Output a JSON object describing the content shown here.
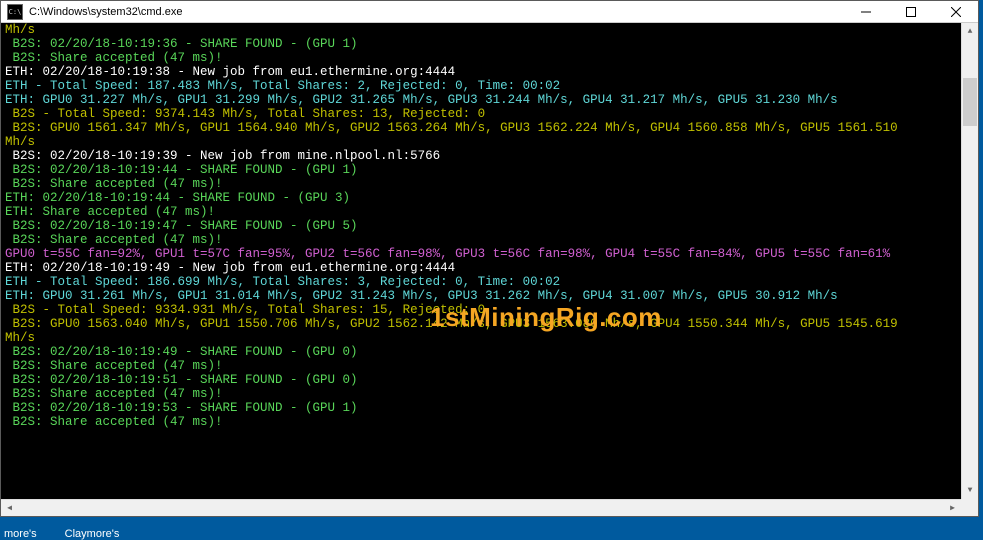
{
  "window": {
    "title": "C:\\Windows\\system32\\cmd.exe",
    "icon_text": "C:\\"
  },
  "watermark": "1stMiningRig.com",
  "taskbar": {
    "item1": "more's",
    "item2": "Claymore's"
  },
  "lines": [
    {
      "cls": "c-yellow",
      "text": "Mh/s"
    },
    {
      "cls": "c-green",
      "text": " B2S: 02/20/18-10:19:36 - SHARE FOUND - (GPU 1)"
    },
    {
      "cls": "c-green",
      "text": " B2S: Share accepted (47 ms)!"
    },
    {
      "cls": "c-white",
      "text": "ETH: 02/20/18-10:19:38 - New job from eu1.ethermine.org:4444"
    },
    {
      "cls": "c-cyan",
      "text": "ETH - Total Speed: 187.483 Mh/s, Total Shares: 2, Rejected: 0, Time: 00:02"
    },
    {
      "cls": "c-cyan",
      "text": "ETH: GPU0 31.227 Mh/s, GPU1 31.299 Mh/s, GPU2 31.265 Mh/s, GPU3 31.244 Mh/s, GPU4 31.217 Mh/s, GPU5 31.230 Mh/s"
    },
    {
      "cls": "c-yellow",
      "text": " B2S - Total Speed: 9374.143 Mh/s, Total Shares: 13, Rejected: 0"
    },
    {
      "cls": "c-yellow",
      "text": " B2S: GPU0 1561.347 Mh/s, GPU1 1564.940 Mh/s, GPU2 1563.264 Mh/s, GPU3 1562.224 Mh/s, GPU4 1560.858 Mh/s, GPU5 1561.510"
    },
    {
      "cls": "c-yellow",
      "text": "Mh/s"
    },
    {
      "cls": "c-white",
      "text": " B2S: 02/20/18-10:19:39 - New job from mine.nlpool.nl:5766"
    },
    {
      "cls": "c-green",
      "text": " B2S: 02/20/18-10:19:44 - SHARE FOUND - (GPU 1)"
    },
    {
      "cls": "c-green",
      "text": " B2S: Share accepted (47 ms)!"
    },
    {
      "cls": "c-green",
      "text": "ETH: 02/20/18-10:19:44 - SHARE FOUND - (GPU 3)"
    },
    {
      "cls": "c-green",
      "text": "ETH: Share accepted (47 ms)!"
    },
    {
      "cls": "c-green",
      "text": " B2S: 02/20/18-10:19:47 - SHARE FOUND - (GPU 5)"
    },
    {
      "cls": "c-green",
      "text": " B2S: Share accepted (47 ms)!"
    },
    {
      "cls": "c-magenta",
      "text": "GPU0 t=55C fan=92%, GPU1 t=57C fan=95%, GPU2 t=56C fan=98%, GPU3 t=56C fan=98%, GPU4 t=55C fan=84%, GPU5 t=55C fan=61%"
    },
    {
      "cls": "c-white",
      "text": "ETH: 02/20/18-10:19:49 - New job from eu1.ethermine.org:4444"
    },
    {
      "cls": "c-cyan",
      "text": "ETH - Total Speed: 186.699 Mh/s, Total Shares: 3, Rejected: 0, Time: 00:02"
    },
    {
      "cls": "c-cyan",
      "text": "ETH: GPU0 31.261 Mh/s, GPU1 31.014 Mh/s, GPU2 31.243 Mh/s, GPU3 31.262 Mh/s, GPU4 31.007 Mh/s, GPU5 30.912 Mh/s"
    },
    {
      "cls": "c-yellow",
      "text": " B2S - Total Speed: 9334.931 Mh/s, Total Shares: 15, Rejected: 0"
    },
    {
      "cls": "c-yellow",
      "text": " B2S: GPU0 1563.040 Mh/s, GPU1 1550.706 Mh/s, GPU2 1562.142 Mh/s, GPU3 1563.080 Mh/s, GPU4 1550.344 Mh/s, GPU5 1545.619"
    },
    {
      "cls": "c-yellow",
      "text": "Mh/s"
    },
    {
      "cls": "c-green",
      "text": " B2S: 02/20/18-10:19:49 - SHARE FOUND - (GPU 0)"
    },
    {
      "cls": "c-green",
      "text": " B2S: Share accepted (47 ms)!"
    },
    {
      "cls": "c-green",
      "text": " B2S: 02/20/18-10:19:51 - SHARE FOUND - (GPU 0)"
    },
    {
      "cls": "c-green",
      "text": " B2S: Share accepted (47 ms)!"
    },
    {
      "cls": "c-green",
      "text": " B2S: 02/20/18-10:19:53 - SHARE FOUND - (GPU 1)"
    },
    {
      "cls": "c-green",
      "text": " B2S: Share accepted (47 ms)!"
    }
  ]
}
